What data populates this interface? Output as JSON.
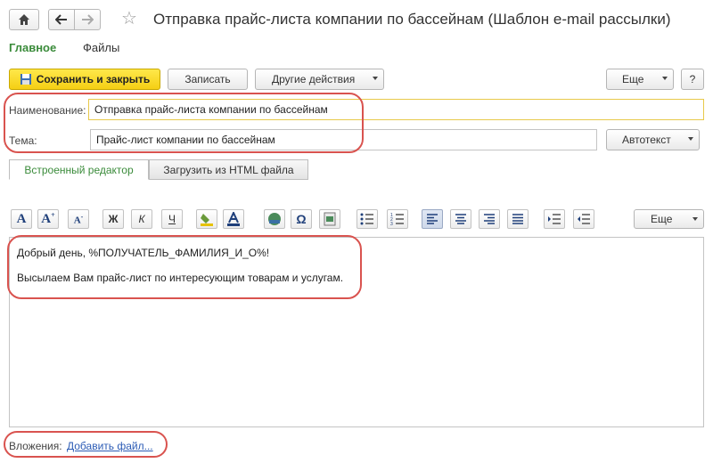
{
  "window": {
    "title": "Отправка прайс-листа компании по бассейнам (Шаблон e-mail рассылки)"
  },
  "sections": {
    "main": "Главное",
    "files": "Файлы"
  },
  "toolbar": {
    "save_close": "Сохранить и закрыть",
    "write": "Записать",
    "other_actions": "Другие действия",
    "more": "Еще",
    "help": "?"
  },
  "form": {
    "name_label": "Наименование:",
    "name_value": "Отправка прайс-листа компании по бассейнам",
    "subject_label": "Тема:",
    "subject_value": "Прайс-лист компании по бассейнам",
    "autotext": "Автотекст"
  },
  "editor_tabs": {
    "builtin": "Встроенный редактор",
    "load_html": "Загрузить из HTML файла"
  },
  "format_toolbar": {
    "bold": "Ж",
    "italic": "К",
    "underline": "Ч",
    "more": "Еще"
  },
  "editor": {
    "line1": "Добрый день, %ПОЛУЧАТЕЛЬ_ФАМИЛИЯ_И_О%!",
    "line2": "Высылаем Вам прайс-лист по интересующим товарам и услугам."
  },
  "attachments": {
    "label": "Вложения:",
    "add_link": "Добавить файл..."
  },
  "colors": {
    "accent_green": "#3a8b3a",
    "primary_yellow": "#f5cf14",
    "highlight_red": "#d9534f"
  }
}
